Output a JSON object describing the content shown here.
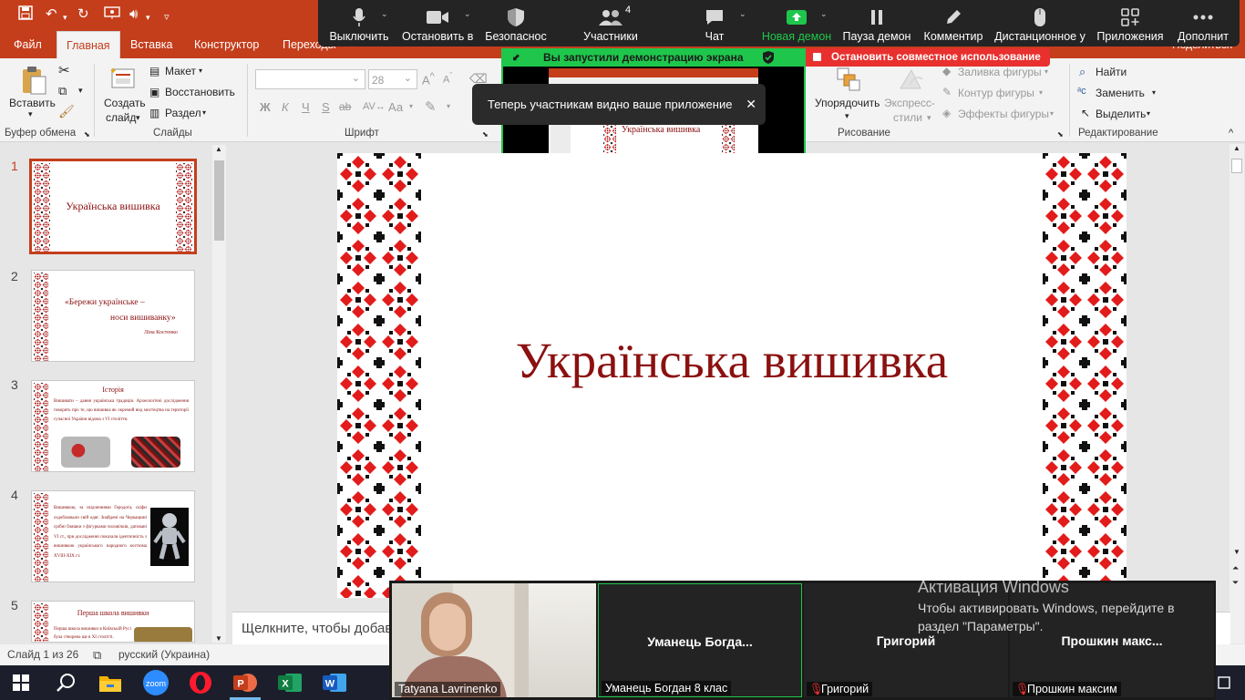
{
  "colors": {
    "accent": "#c43e1c",
    "zoom_green": "#1ec74b",
    "zoom_red": "#e8302e",
    "title_red": "#8b1010"
  },
  "ribbon_tabs": [
    {
      "label": "Файл",
      "active": false
    },
    {
      "label": "Главная",
      "active": true
    },
    {
      "label": "Вставка",
      "active": false
    },
    {
      "label": "Конструктор",
      "active": false
    },
    {
      "label": "Переходы",
      "active": false
    }
  ],
  "ribbon_right": "Поделиться",
  "ribbon": {
    "paste": "Вставить",
    "clipboard_group": "Буфер обмена",
    "new_slide_line1": "Создать",
    "new_slide_line2": "слайд",
    "layout": "Макет",
    "reset": "Восстановить",
    "section": "Раздел",
    "slides_group": "Слайды",
    "font_size": "28",
    "font_group": "Шрифт",
    "font_buttons": [
      "Ж",
      "К",
      "Ч",
      "S",
      "ab",
      "Аа"
    ],
    "arrange": "Упорядочить",
    "quick_styles_line1": "Экспресс-",
    "quick_styles_line2": "стили",
    "shape_fill": "Заливка фигуры",
    "shape_outline": "Контур фигуры",
    "shape_effects": "Эффекты фигуры",
    "drawing_group": "Рисование",
    "find": "Найти",
    "replace": "Заменить",
    "select": "Выделить",
    "editing_group": "Редактирование"
  },
  "zoom_toolbar": [
    {
      "label": "Выключить",
      "icon": "microphone-icon"
    },
    {
      "label": "Остановить в",
      "icon": "video-camera-icon"
    },
    {
      "label": "Безопаснос",
      "icon": "shield-icon"
    },
    {
      "label": "Участники",
      "icon": "participants-icon",
      "badge": "4"
    },
    {
      "label": "Чат",
      "icon": "chat-bubble-icon"
    },
    {
      "label": "Новая демон",
      "icon": "share-screen-icon"
    },
    {
      "label": "Пауза демон",
      "icon": "pause-icon"
    },
    {
      "label": "Комментир",
      "icon": "pencil-icon"
    },
    {
      "label": "Дистанционное у",
      "icon": "mouse-icon"
    },
    {
      "label": "Приложения",
      "icon": "apps-icon"
    },
    {
      "label": "Дополнит",
      "icon": "more-icon"
    }
  ],
  "share_banner": "Вы запустили демонстрацию экрана",
  "stop_share": "Остановить совместное использование",
  "preview_title": "Українська вишивка",
  "toast": "Теперь участникам видно ваше приложение",
  "slides": [
    {
      "num": "1",
      "title": "Українська вишивка"
    },
    {
      "num": "2",
      "title": "«Бережи українське –",
      "title2": "носи вишиванку»",
      "author": "Ліна Костенко"
    },
    {
      "num": "3",
      "title": "Історія",
      "body": "Вишивати – давня українська традиція. Археологічні дослідження говорять про те, що вишивка як окремий вид мистецтва на території сучасної України відома з VI століття."
    },
    {
      "num": "4",
      "body": "Вишивкою, за свідченнями Геродота, скіфи оздоблювали свій одяг. Знайдені на Черкащині срібні бляшки з фігурками чоловічків, датовані VI ст., при дослідженні показали ідентичність з вишивкою українського народного костюма XVIII-XIX ст."
    },
    {
      "num": "5",
      "title": "Перша школа вишивки",
      "body": "Перша школа вишивки в Київській Русі була створена ще в XI столітті."
    }
  ],
  "main_slide_title": "Українська вишивка",
  "notes_placeholder": "Щелкните, чтобы добавить заметки",
  "status": {
    "slide": "Слайд 1 из 26",
    "language": "русский (Украина)"
  },
  "activate": {
    "title": "Активация Windows",
    "line1": "Чтобы активировать Windows, перейдите в",
    "line2": "раздел \"Параметры\"."
  },
  "video_tiles": [
    {
      "name": "",
      "label": "Tatyana Lavrinenko",
      "muted": false
    },
    {
      "name": "Уманець Богда...",
      "label": "Уманець Богдан 8 клас",
      "muted": false
    },
    {
      "name": "Григорий",
      "label": "Григорий",
      "muted": true
    },
    {
      "name": "Прошкин макс...",
      "label": "Прошкин максим",
      "muted": true
    }
  ],
  "taskbar": [
    "windows-start-icon",
    "search-icon",
    "file-explorer-icon",
    "zoom-app-icon",
    "opera-icon",
    "powerpoint-icon",
    "excel-icon",
    "word-icon"
  ]
}
